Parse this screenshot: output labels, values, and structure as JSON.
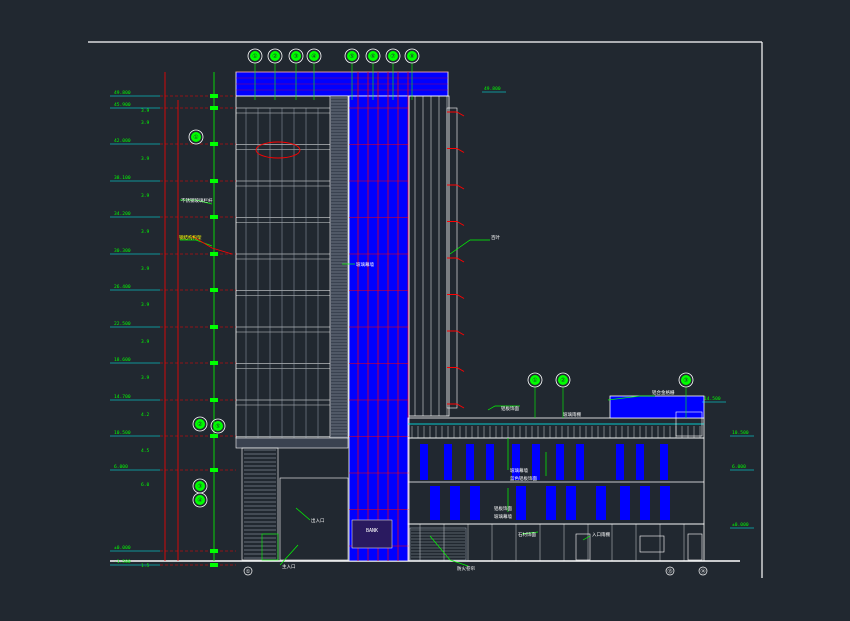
{
  "drawing": {
    "background_color": "#212830",
    "line_color": "#ffffff",
    "tower_fill_color": "#0000ff",
    "accent_red": "#ff0000",
    "accent_green": "#00ff00",
    "accent_cyan": "#00ffff",
    "accent_yellow": "#ffff00",
    "level_marks": [
      {
        "elev": "49.800",
        "height": "3.9"
      },
      {
        "elev": "45.900",
        "height": "3.9"
      },
      {
        "elev": "42.000",
        "height": "3.9"
      },
      {
        "elev": "38.100",
        "height": "3.9"
      },
      {
        "elev": "34.200",
        "height": "3.9"
      },
      {
        "elev": "30.300",
        "height": "3.9"
      },
      {
        "elev": "26.400",
        "height": "3.9"
      },
      {
        "elev": "22.500",
        "height": "3.9"
      },
      {
        "elev": "18.600",
        "height": "3.9"
      },
      {
        "elev": "14.700",
        "height": "4.2"
      },
      {
        "elev": "10.500",
        "height": "4.5"
      },
      {
        "elev": "6.000",
        "height": "6.0"
      },
      {
        "elev": "±0.000",
        "height": "1.5"
      },
      {
        "elev": "-1.500",
        "height": ""
      }
    ],
    "right_level_marks": [
      "49.800",
      "14.500",
      "10.500",
      "6.000",
      "±0.000"
    ],
    "top_bubbles": [
      "①",
      "②",
      "③",
      "④",
      "⑤",
      "⑥",
      "⑦",
      "⑧"
    ],
    "podium_bubbles": [
      "①",
      "②",
      "③"
    ],
    "left_bubbles": [
      "①",
      "②",
      "③",
      "④",
      "⑤"
    ],
    "axis_labels": [
      "①",
      "⑬",
      "⑭"
    ],
    "callouts": {
      "stair_glass": "不锈钢玻璃栏杆",
      "red_note": "钢结构构架",
      "tower_note": "玻璃幕墙",
      "right_note": "百叶",
      "roof_note": "铝合金格栅",
      "podium_top_a": "铝板饰面",
      "podium_top_b": "玻璃雨棚",
      "podium_mid_a": "玻璃幕墙",
      "podium_mid_b": "蓝色铝板饰面",
      "podium_low_a": "铝板饰面",
      "podium_low_b": "玻璃幕墙",
      "ground_a": "石材饰面",
      "ground_b": "入口雨棚",
      "ground_c": "防火卷帘",
      "ground_d": "出入口",
      "entrance": "主入口",
      "sign": "BANK"
    }
  }
}
